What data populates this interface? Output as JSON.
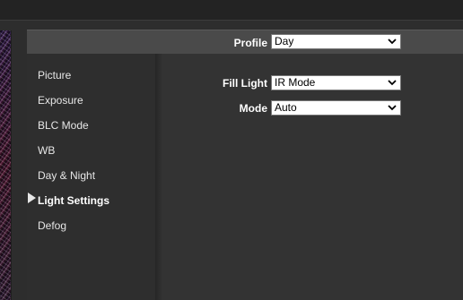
{
  "profile": {
    "label": "Profile",
    "value": "Day"
  },
  "sidebar": {
    "items": [
      {
        "label": "Picture",
        "active": false
      },
      {
        "label": "Exposure",
        "active": false
      },
      {
        "label": "BLC Mode",
        "active": false
      },
      {
        "label": "WB",
        "active": false
      },
      {
        "label": "Day & Night",
        "active": false
      },
      {
        "label": "Light Settings",
        "active": true
      },
      {
        "label": "Defog",
        "active": false
      }
    ]
  },
  "light_settings": {
    "fill_light": {
      "label": "Fill Light",
      "value": "IR Mode"
    },
    "mode": {
      "label": "Mode",
      "value": "Auto"
    }
  },
  "icons": {
    "dropdown": "chevron-down-icon",
    "active_marker": "triangle-right-icon"
  },
  "colors": {
    "background": "#2d2d2d",
    "profile_bar": "#4a4a4a",
    "text": "#ffffff",
    "menu_text": "#e6e6e6"
  }
}
